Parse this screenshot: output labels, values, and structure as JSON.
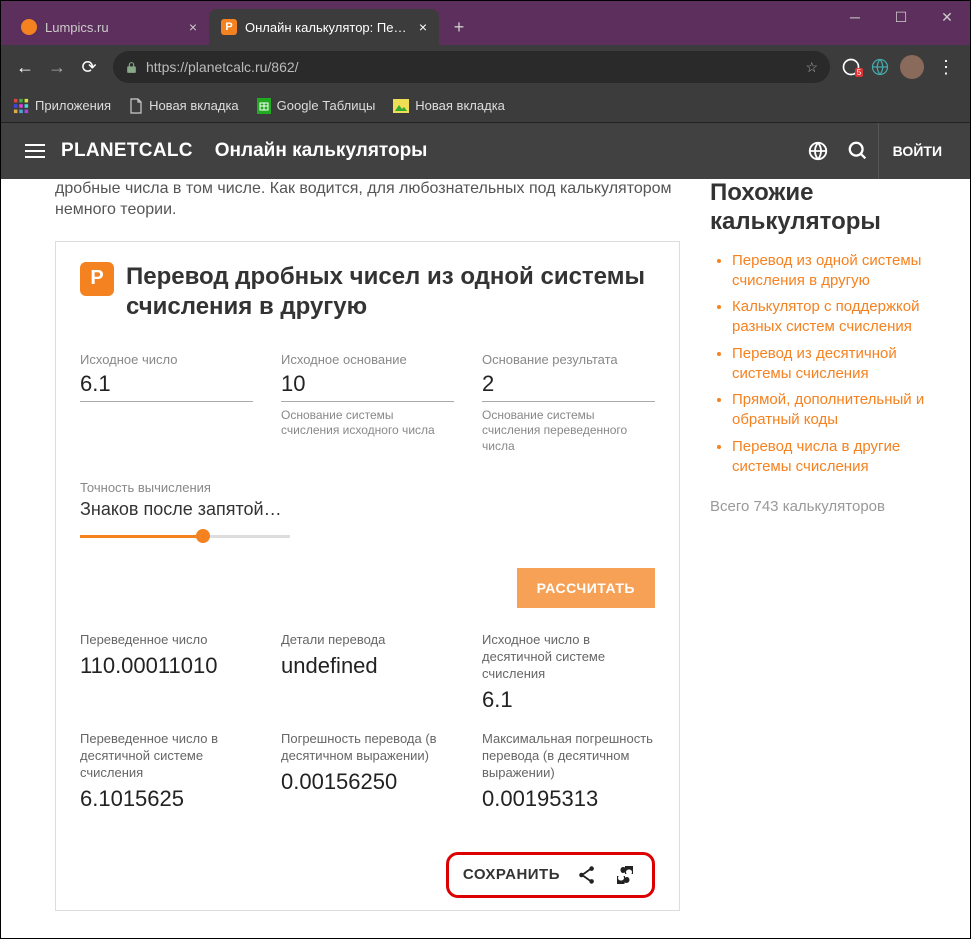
{
  "browser": {
    "tabs": [
      {
        "title": "Lumpics.ru",
        "favicon_color": "#f58220"
      },
      {
        "title": "Онлайн калькулятор: Перевод ...",
        "favicon_color": "#f58220"
      }
    ],
    "url_display": "https://planetcalc.ru/862/",
    "bookmarks": [
      {
        "label": "Приложения"
      },
      {
        "label": "Новая вкладка"
      },
      {
        "label": "Google Таблицы"
      },
      {
        "label": "Новая вкладка"
      }
    ]
  },
  "header": {
    "brand": "PLANETCALC",
    "subtitle": "Онлайн калькуляторы",
    "login": "ВОЙТИ"
  },
  "intro": "дробные числа в том числе. Как водится, для любознательных под калькулятором немного теории.",
  "card": {
    "title": "Перевод дробных чисел из одной системы счисления в другую",
    "fields": {
      "source_number": {
        "label": "Исходное число",
        "value": "6.1"
      },
      "source_base": {
        "label": "Исходное основание",
        "value": "10",
        "help": "Основание системы счисления исходного числа"
      },
      "target_base": {
        "label": "Основание результата",
        "value": "2",
        "help": "Основание системы счисления переведенного числа"
      }
    },
    "precision": {
      "label": "Точность вычисления",
      "value_text": "Знаков после запятой…"
    },
    "calc_label": "РАССЧИТАТЬ",
    "results": [
      {
        "label": "Переведенное число",
        "value": "110.00011010"
      },
      {
        "label": "Детали перевода",
        "value": "undefined"
      },
      {
        "label": "Исходное число в десятичной системе счисления",
        "value": "6.1"
      },
      {
        "label": "Переведенное число в десятичной системе счисления",
        "value": "6.1015625"
      },
      {
        "label": "Погрешность перевода (в десятичном выражении)",
        "value": "0.00156250"
      },
      {
        "label": "Максимальная погрешность перевода (в десятичном выражении)",
        "value": "0.00195313"
      }
    ],
    "save_label": "СОХРАНИТЬ"
  },
  "sidebar": {
    "title": "Похожие калькуляторы",
    "items": [
      "Перевод из одной системы счисления в другую",
      "Калькулятор с поддержкой разных систем счисления",
      "Перевод из десятичной системы счисления",
      "Прямой, дополнительный и обратный коды",
      "Перевод числа в другие системы счисления"
    ],
    "footer": "Всего 743 калькуляторов"
  }
}
